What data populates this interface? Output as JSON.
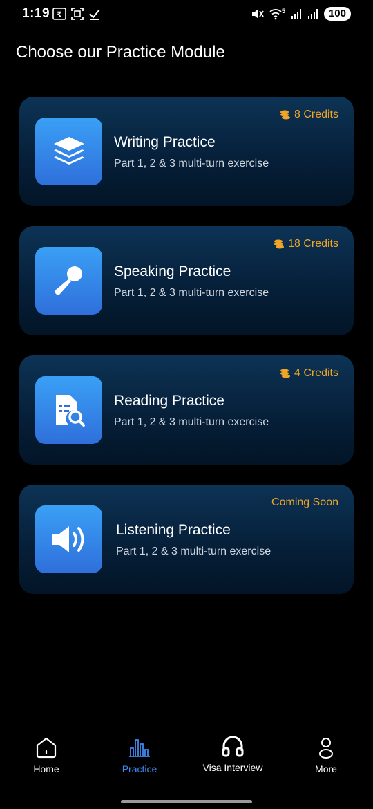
{
  "status_bar": {
    "time": "1:19",
    "left_icons": [
      "rupee-icon",
      "screenshot-icon",
      "check-icon"
    ],
    "right_icons": [
      "mute-icon",
      "wifi-icon",
      "signal-icon",
      "signal-icon"
    ],
    "wifi_label": "5",
    "battery": "100"
  },
  "page": {
    "title": "Choose our Practice Module"
  },
  "modules": [
    {
      "title": "Writing Practice",
      "subtitle": "Part 1, 2 & 3 multi-turn exercise",
      "badge": "8 Credits",
      "icon": "layers-icon",
      "has_coin": true
    },
    {
      "title": "Speaking Practice",
      "subtitle": "Part 1, 2 & 3 multi-turn exercise",
      "badge": "18 Credits",
      "icon": "microphone-icon",
      "has_coin": true
    },
    {
      "title": "Reading Practice",
      "subtitle": "Part 1, 2 & 3 multi-turn exercise",
      "badge": "4 Credits",
      "icon": "document-search-icon",
      "has_coin": true
    },
    {
      "title": "Listening Practice",
      "subtitle": "Part 1, 2 & 3 multi-turn exercise",
      "badge": "Coming Soon",
      "icon": "speaker-icon",
      "has_coin": false
    }
  ],
  "bottom_nav": {
    "items": [
      {
        "label": "Home",
        "icon": "home-icon",
        "active": false
      },
      {
        "label": "Practice",
        "icon": "bar-chart-icon",
        "active": true
      },
      {
        "label": "Visa Interview",
        "icon": "headphones-icon",
        "active": false
      },
      {
        "label": "More",
        "icon": "user-icon",
        "active": false
      }
    ]
  },
  "colors": {
    "background": "#000000",
    "card_top": "#0d3355",
    "card_bottom": "#031426",
    "icon_gradient_top": "#3aa0f5",
    "icon_gradient_bottom": "#2f6fdb",
    "credits": "#f0a527",
    "active_nav": "#3d8af0"
  }
}
